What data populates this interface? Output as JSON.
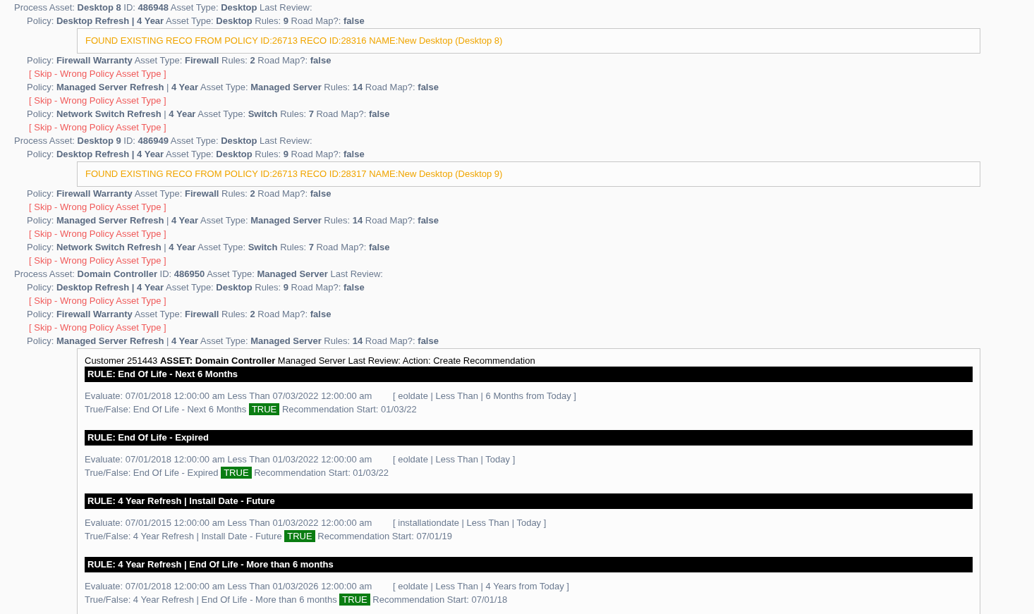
{
  "log": [
    {
      "kind": "asset",
      "text": "Process Asset: **Desktop 8** ID: **486948** Asset Type: **Desktop** Last Review:"
    },
    {
      "kind": "policy",
      "text": "Policy: **Desktop Refresh | 4 Year** Asset Type: **Desktop** Rules: **9** Road Map?: **false**"
    },
    {
      "kind": "found",
      "text": "FOUND EXISTING RECO FROM POLICY ID:26713 RECO ID:28316 NAME:New Desktop (Desktop 8)"
    },
    {
      "kind": "policy",
      "text": "Policy: **Firewall Warranty** Asset Type: **Firewall** Rules: **2** Road Map?: **false**"
    },
    {
      "kind": "skip",
      "text": "[ Skip - Wrong Policy Asset Type ]"
    },
    {
      "kind": "policy",
      "text": "Policy: **Managed Server Refresh** | **4 Year** Asset Type: **Managed Server** Rules: **14** Road Map?: **false**"
    },
    {
      "kind": "skip",
      "text": "[ Skip - Wrong Policy Asset Type ]"
    },
    {
      "kind": "policy",
      "text": "Policy: **Network Switch Refresh** | **4 Year** Asset Type: **Switch** Rules: **7** Road Map?: **false**"
    },
    {
      "kind": "skip",
      "text": "[ Skip - Wrong Policy Asset Type ]"
    },
    {
      "kind": "asset",
      "text": "Process Asset: **Desktop 9** ID: **486949** Asset Type: **Desktop** Last Review:"
    },
    {
      "kind": "policy",
      "text": "Policy: **Desktop Refresh | 4 Year** Asset Type: **Desktop** Rules: **9** Road Map?: **false**"
    },
    {
      "kind": "found",
      "text": "FOUND EXISTING RECO FROM POLICY ID:26713 RECO ID:28317 NAME:New Desktop (Desktop 9)"
    },
    {
      "kind": "policy",
      "text": "Policy: **Firewall Warranty** Asset Type: **Firewall** Rules: **2** Road Map?: **false**"
    },
    {
      "kind": "skip",
      "text": "[ Skip - Wrong Policy Asset Type ]"
    },
    {
      "kind": "policy",
      "text": "Policy: **Managed Server Refresh** | **4 Year** Asset Type: **Managed Server** Rules: **14** Road Map?: **false**"
    },
    {
      "kind": "skip",
      "text": "[ Skip - Wrong Policy Asset Type ]"
    },
    {
      "kind": "policy",
      "text": "Policy: **Network Switch Refresh** | **4 Year** Asset Type: **Switch** Rules: **7** Road Map?: **false**"
    },
    {
      "kind": "skip",
      "text": "[ Skip - Wrong Policy Asset Type ]"
    },
    {
      "kind": "asset",
      "text": "Process Asset: **Domain Controller** ID: **486950** Asset Type: **Managed Server** Last Review:"
    },
    {
      "kind": "policy",
      "text": "Policy: **Desktop Refresh | 4 Year** Asset Type: **Desktop** Rules: **9** Road Map?: **false**"
    },
    {
      "kind": "skip",
      "text": "[ Skip - Wrong Policy Asset Type ]"
    },
    {
      "kind": "policy",
      "text": "Policy: **Firewall Warranty** Asset Type: **Firewall** Rules: **2** Road Map?: **false**"
    },
    {
      "kind": "skip",
      "text": "[ Skip - Wrong Policy Asset Type ]"
    },
    {
      "kind": "policy",
      "text": "Policy: **Managed Server Refresh** | **4 Year** Asset Type: **Managed Server** Rules: **14** Road Map?: **false**"
    }
  ],
  "recommendation": {
    "header": "Customer 251443 **ASSET: Domain Controller** Managed Server Last Review: Action: Create Recommendation",
    "rules": [
      {
        "title": "RULE: End Of Life - Next 6 Months",
        "evaluate": "Evaluate: 07/01/2018 12:00:00 am Less Than 07/03/2022 12:00:00 am",
        "criteria": "[ eoldate | Less Than | 6 Months from Today ]",
        "true_false": "True/False: End Of Life - Next 6 Months",
        "result": "TRUE",
        "passed": true,
        "start": "Recommendation Start: 01/03/22"
      },
      {
        "title": "RULE: End Of Life - Expired",
        "evaluate": "Evaluate: 07/01/2018 12:00:00 am Less Than 01/03/2022 12:00:00 am",
        "criteria": "[ eoldate | Less Than | Today ]",
        "true_false": "True/False: End Of Life - Expired",
        "result": "TRUE",
        "passed": true,
        "start": "Recommendation Start: 01/03/22"
      },
      {
        "title": "RULE: 4 Year Refresh | Install Date - Future",
        "evaluate": "Evaluate: 07/01/2015 12:00:00 am Less Than 01/03/2022 12:00:00 am",
        "criteria": "[ installationdate | Less Than | Today ]",
        "true_false": "True/False: 4 Year Refresh | Install Date - Future",
        "result": "TRUE",
        "passed": true,
        "start": "Recommendation Start: 07/01/19"
      },
      {
        "title": "RULE: 4 Year Refresh | End Of Life - More than 6 months",
        "evaluate": "Evaluate: 07/01/2018 12:00:00 am Less Than 01/03/2026 12:00:00 am",
        "criteria": "[ eoldate | Less Than | 4 Years from Today ]",
        "true_false": "True/False: 4 Year Refresh | End Of Life - More than 6 months",
        "result": "TRUE",
        "passed": true,
        "start": "Recommendation Start: 07/01/18"
      }
    ]
  }
}
